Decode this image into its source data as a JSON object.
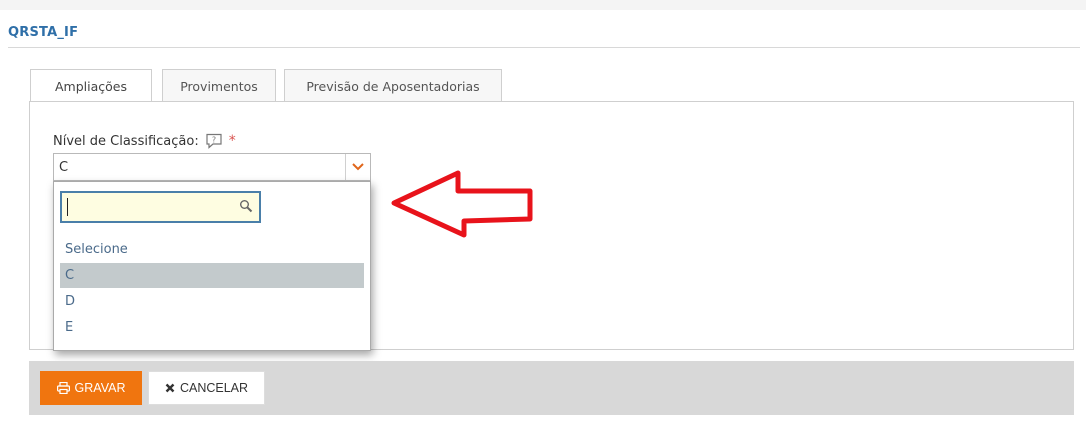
{
  "page": {
    "title": "QRSTA_IF"
  },
  "tabs": [
    {
      "label": "Ampliações",
      "active": true
    },
    {
      "label": "Provimentos",
      "active": false
    },
    {
      "label": "Previsão de Aposentadorias",
      "active": false
    }
  ],
  "field": {
    "label": "Nível de Classificação:",
    "required_mark": "*",
    "selected_value": "C",
    "help_icon": "help-speech-icon"
  },
  "dropdown": {
    "search_value": "",
    "search_placeholder": "",
    "options": [
      "Selecione",
      "C",
      "D",
      "E"
    ],
    "selected_option": "C"
  },
  "actions": {
    "save_label": "GRAVAR",
    "cancel_label": "CANCELAR"
  },
  "colors": {
    "title": "#2f6fa8",
    "save_button": "#f0750f",
    "annotation_arrow": "#e8131b",
    "search_bg": "#fefde1"
  }
}
